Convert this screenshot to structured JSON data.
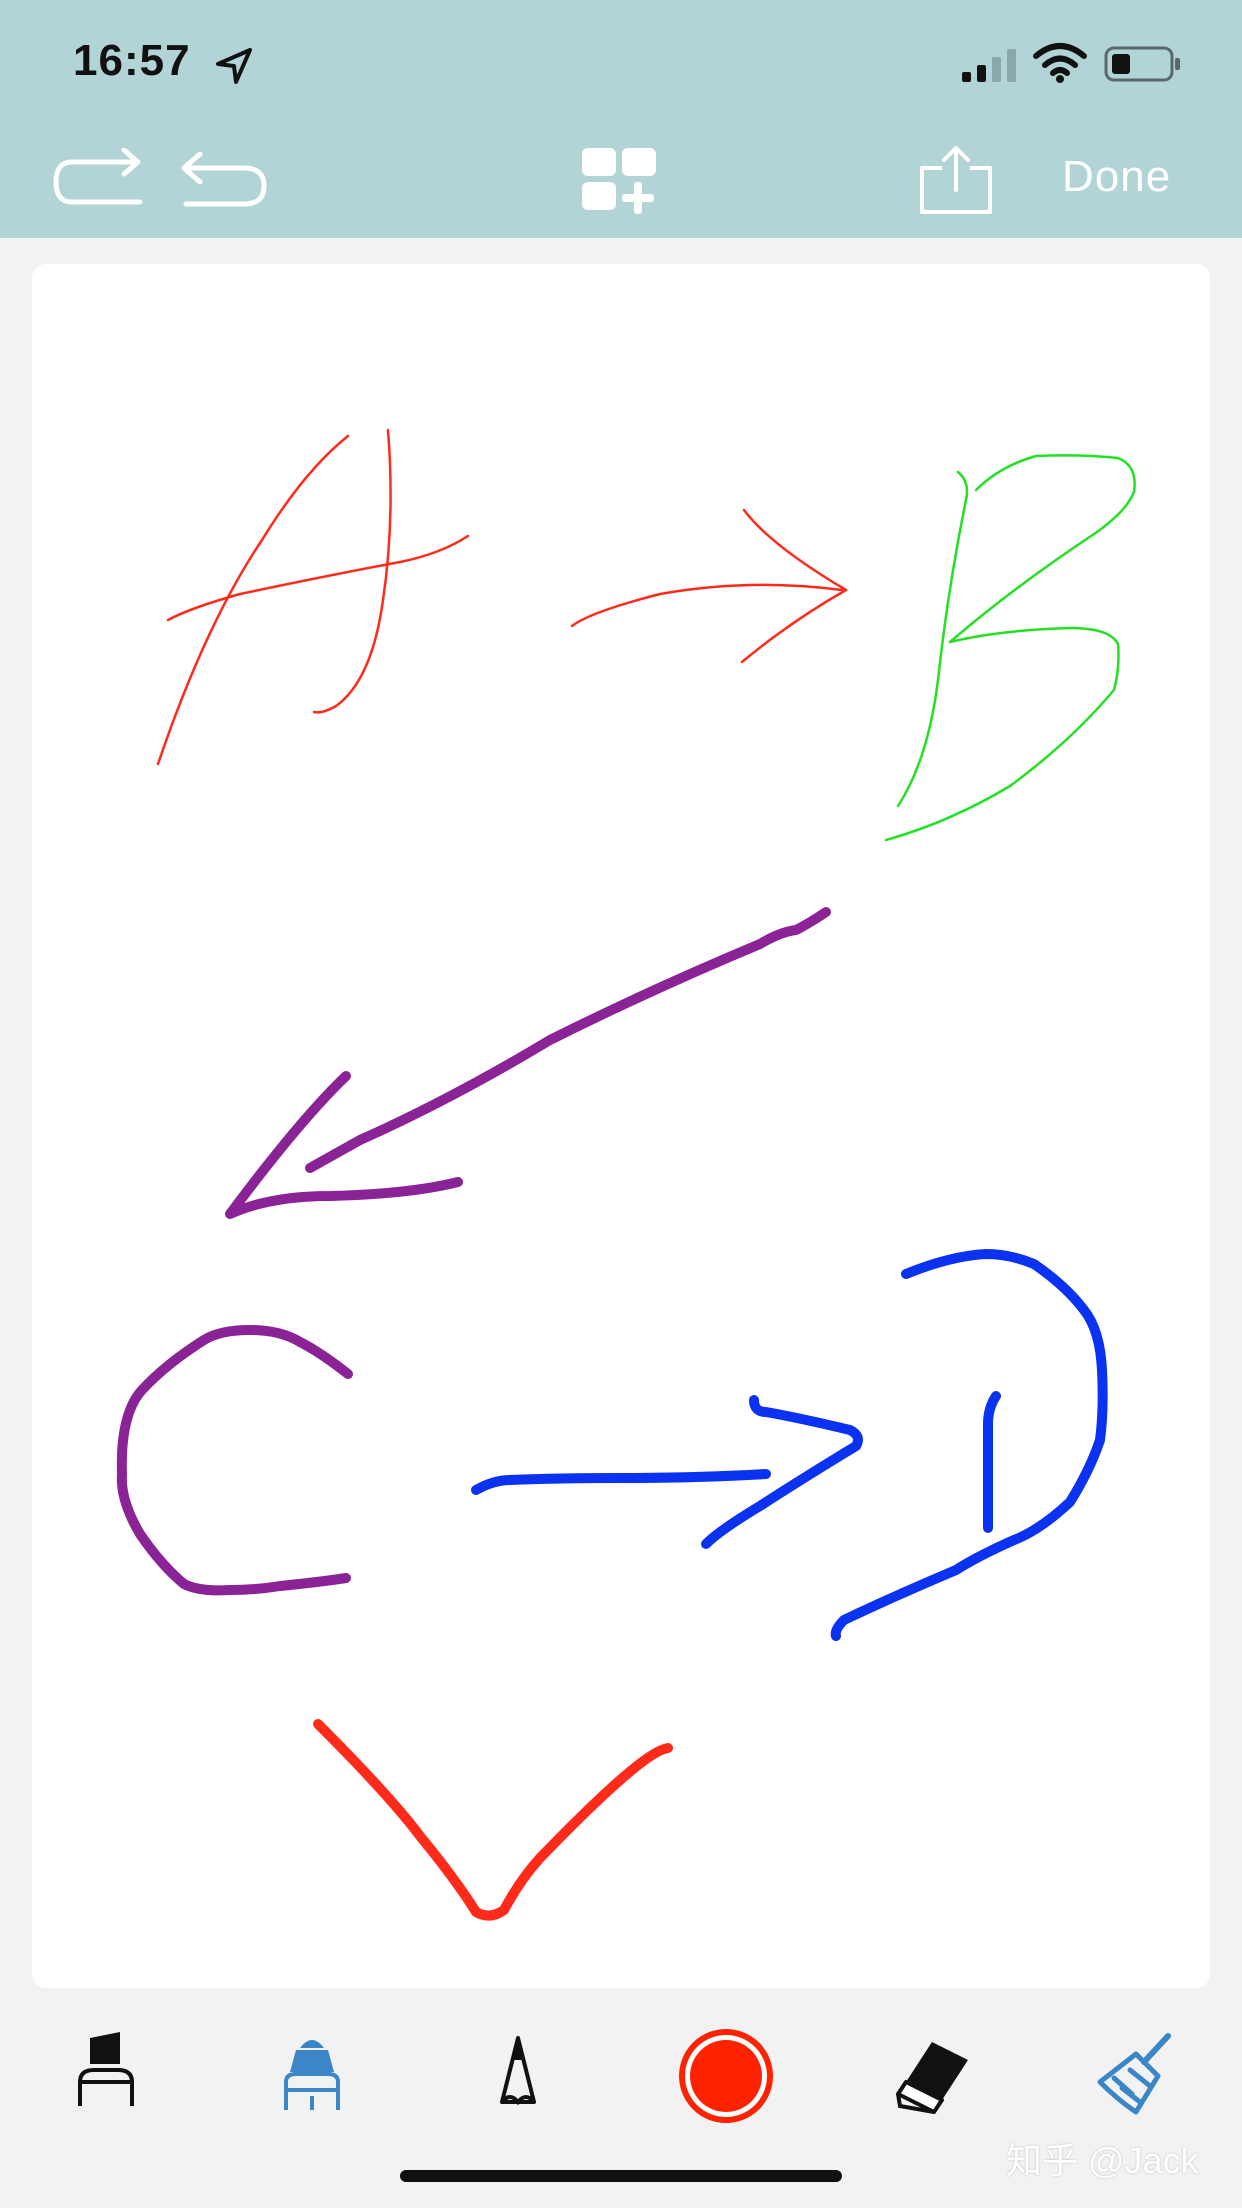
{
  "status_bar": {
    "time": "16:57",
    "icons": [
      "location-arrow-icon",
      "cellular-signal-icon",
      "wifi-icon",
      "battery-low-icon"
    ]
  },
  "toolbar": {
    "icons": [
      "redo-icon",
      "undo-icon",
      "add-widget-icon",
      "share-icon"
    ],
    "done_label": "Done"
  },
  "tools": {
    "icons": [
      "marker-tool-icon",
      "highlighter-tool-icon",
      "pencil-tool-icon",
      "color-picker-icon",
      "eraser-tool-icon",
      "broom-clear-icon"
    ],
    "selected_tool": "highlighter",
    "selected_color": "#ff2200"
  },
  "stroke_colors": {
    "red": "#ff2a1a",
    "green": "#22e022",
    "purple": "#8a2496",
    "blue": "#0a32f0",
    "accent_blue": "#3b86c6"
  },
  "watermark": "知乎 @Jack"
}
